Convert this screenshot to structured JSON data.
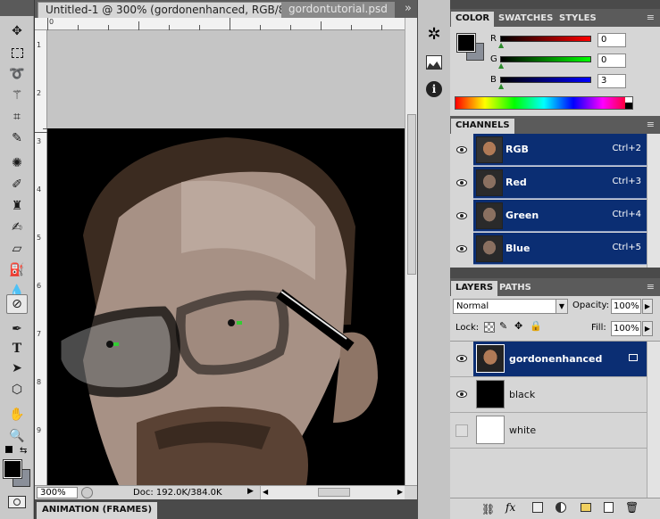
{
  "document": {
    "tabs": [
      {
        "label": "Untitled-1 @ 300% (gordonenhanced, RGB/8) *",
        "active": true
      },
      {
        "label": "gordontutorial.psd",
        "active": false
      }
    ],
    "overflow_label": "»",
    "close_glyph": "×",
    "ruler_top_numbers": [
      "0",
      "",
      "",
      "",
      "",
      ""
    ],
    "ruler_left_numbers": [
      "1",
      "2",
      "3",
      "4",
      "5",
      "6",
      "7",
      "8",
      "9"
    ],
    "zoom": "300%",
    "doc_info": "Doc: 192.0K/384.0K",
    "animation_title": "ANIMATION (FRAMES)"
  },
  "color_panel": {
    "tabs": [
      "COLOR",
      "SWATCHES",
      "STYLES"
    ],
    "channels": [
      {
        "label": "R",
        "value": "0",
        "color": "#d00000"
      },
      {
        "label": "G",
        "value": "0",
        "color": "#00c000"
      },
      {
        "label": "B",
        "value": "3",
        "color": "#0000e0"
      }
    ],
    "foreground": "#000000",
    "background": "#8a8f99"
  },
  "channels_panel": {
    "title": "CHANNELS",
    "rows": [
      {
        "name": "RGB",
        "shortcut": "Ctrl+2"
      },
      {
        "name": "Red",
        "shortcut": "Ctrl+3"
      },
      {
        "name": "Green",
        "shortcut": "Ctrl+4"
      },
      {
        "name": "Blue",
        "shortcut": "Ctrl+5"
      }
    ]
  },
  "layers_panel": {
    "tabs": [
      "LAYERS",
      "PATHS"
    ],
    "blend_mode": "Normal",
    "opacity_label": "Opacity:",
    "opacity": "100%",
    "lock_label": "Lock:",
    "fill_label": "Fill:",
    "fill": "100%",
    "layers": [
      {
        "name": "gordonenhanced",
        "visible": true,
        "selected": true
      },
      {
        "name": "black",
        "visible": true,
        "selected": false
      },
      {
        "name": "white",
        "visible": false,
        "selected": false
      }
    ]
  },
  "icons": {
    "tools": [
      "move-icon",
      "marquee-icon",
      "lasso-icon",
      "magic-wand-icon",
      "crop-icon",
      "eyedropper-icon",
      "spot-healing-icon",
      "brush-icon",
      "clone-stamp-icon",
      "history-brush-icon",
      "eraser-icon",
      "paint-bucket-icon",
      "blur-icon",
      "dodge-icon",
      "pen-icon",
      "type-icon",
      "path-select-icon",
      "shape-icon",
      "hand-icon",
      "zoom-icon"
    ]
  }
}
